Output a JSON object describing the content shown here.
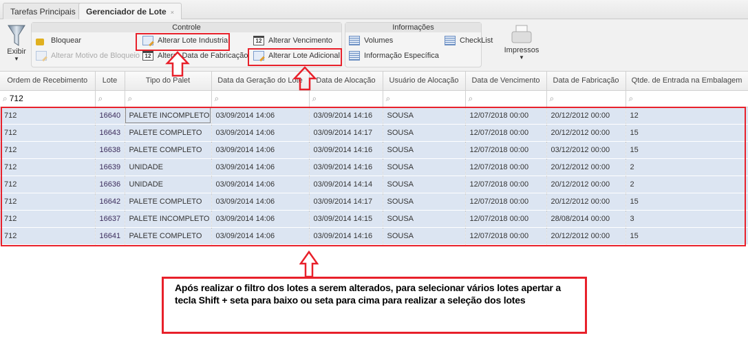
{
  "tabs": [
    {
      "label": "Tarefas Principais"
    },
    {
      "label": "Gerenciador de Lote",
      "close": "×"
    }
  ],
  "toolbar": {
    "exibir": "Exibir",
    "controle": {
      "title": "Controle",
      "bloquear": "Bloquear",
      "alterar_motivo": "Alterar Motivo de Bloqueio",
      "alterar_lote_industria": "Alterar Lote Industria",
      "alterar_data_fabricacao": "Alterar Data de Fabricação",
      "alterar_vencimento": "Alterar Vencimento",
      "alterar_lote_adicional": "Alterar Lote Adicional",
      "cal_day": "12"
    },
    "informacoes": {
      "title": "Informações",
      "volumes": "Volumes",
      "checklist": "CheckList",
      "info_especifica": "Informação Específica"
    },
    "impressos": "Impressos"
  },
  "grid": {
    "columns": [
      "Ordem de Recebimento",
      "Lote",
      "Tipo do Palet",
      "Data da Geração do Lote",
      "Data de Alocação",
      "Usuário de Alocação",
      "Data de Vencimento",
      "Data de Fabricação",
      "Qtde. de Entrada na Embalagem"
    ],
    "filter_value": "712",
    "rows": [
      [
        "712",
        "16640",
        "PALETE INCOMPLETO",
        "03/09/2014 14:06",
        "03/09/2014 14:16",
        "SOUSA",
        "12/07/2018 00:00",
        "20/12/2012 00:00",
        "12"
      ],
      [
        "712",
        "16643",
        "PALETE COMPLETO",
        "03/09/2014 14:06",
        "03/09/2014 14:17",
        "SOUSA",
        "12/07/2018 00:00",
        "20/12/2012 00:00",
        "15"
      ],
      [
        "712",
        "16638",
        "PALETE COMPLETO",
        "03/09/2014 14:06",
        "03/09/2014 14:16",
        "SOUSA",
        "12/07/2018 00:00",
        "03/12/2012 00:00",
        "15"
      ],
      [
        "712",
        "16639",
        "UNIDADE",
        "03/09/2014 14:06",
        "03/09/2014 14:16",
        "SOUSA",
        "12/07/2018 00:00",
        "20/12/2012 00:00",
        "2"
      ],
      [
        "712",
        "16636",
        "UNIDADE",
        "03/09/2014 14:06",
        "03/09/2014 14:14",
        "SOUSA",
        "12/07/2018 00:00",
        "20/12/2012 00:00",
        "2"
      ],
      [
        "712",
        "16642",
        "PALETE COMPLETO",
        "03/09/2014 14:06",
        "03/09/2014 14:17",
        "SOUSA",
        "12/07/2018 00:00",
        "20/12/2012 00:00",
        "15"
      ],
      [
        "712",
        "16637",
        "PALETE INCOMPLETO",
        "03/09/2014 14:06",
        "03/09/2014 14:15",
        "SOUSA",
        "12/07/2018 00:00",
        "28/08/2014 00:00",
        "3"
      ],
      [
        "712",
        "16641",
        "PALETE COMPLETO",
        "03/09/2014 14:06",
        "03/09/2014 14:16",
        "SOUSA",
        "12/07/2018 00:00",
        "20/12/2012 00:00",
        "15"
      ]
    ]
  },
  "annotation": {
    "text": "Após realizar o filtro dos lotes a serem alterados, para selecionar vários lotes apertar a tecla Shift + seta para baixo ou seta para cima para realizar a seleção dos lotes",
    "color": "#e8202a"
  }
}
